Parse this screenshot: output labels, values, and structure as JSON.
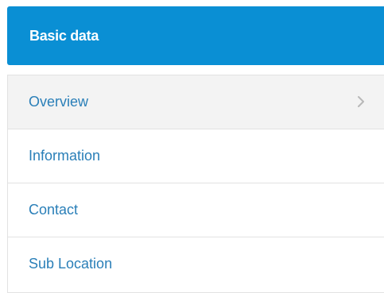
{
  "panel": {
    "title": "Basic data"
  },
  "nav": {
    "items": [
      {
        "label": "Overview",
        "active": true
      },
      {
        "label": "Information"
      },
      {
        "label": "Contact"
      },
      {
        "label": "Sub Location"
      }
    ]
  },
  "colors": {
    "header_bg": "#0a8fd4",
    "link": "#2a7fb8",
    "active_bg": "#f3f3f3",
    "border": "#e2e2e2"
  },
  "icons": {
    "overview_indicator": "chevron-right-icon"
  }
}
